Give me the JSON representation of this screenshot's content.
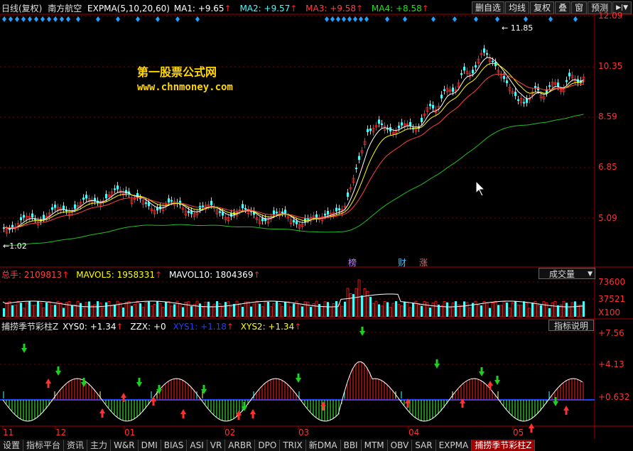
{
  "header": {
    "period": "日线(复权)",
    "stock": "南方航空",
    "indicator": "EXPMA(5,10,20,60)",
    "ma1": "MA1: +9.65",
    "ma2": "MA2: +9.57",
    "ma3": "MA3: +9.58",
    "ma4": "MA4: +8.58",
    "buttons": [
      "删自选",
      "均线",
      "复权",
      "叠",
      "窗",
      "预测"
    ],
    "nav_icon": "arrow-icon"
  },
  "watermark": {
    "line1": "第一股票公式网",
    "line2": "www.chnmoney.com"
  },
  "price_axis": [
    "12.09",
    "10.35",
    "8.59",
    "6.85",
    "5.09"
  ],
  "high_label": "11.85",
  "low_label": "1.02",
  "event_flags": [
    {
      "text": "榜",
      "color": "#c080ff"
    },
    {
      "text": "财",
      "color": "#40c0ff"
    },
    {
      "text": "涨",
      "color": "#ff6060"
    }
  ],
  "volume": {
    "total": "总手: 2109813",
    "mavol5": "MAVOL5: 1958331",
    "mavol10": "MAVOL10: 1804369",
    "dropdown": "成交量",
    "axis": [
      "73600",
      "37521",
      "X100"
    ]
  },
  "indicator_panel": {
    "name": "捕捞季节彩柱Z",
    "xys0": "XYS0: +1.34",
    "zzx": "ZZX: +0",
    "xys1": "XYS1: +1.18",
    "xys2": "XYS2: +1.34",
    "explain": "指标说明",
    "axis": [
      "+7.56",
      "+4.13",
      "+0.632"
    ]
  },
  "time_axis": [
    "11",
    "12",
    "01",
    "02",
    "03",
    "04",
    "05"
  ],
  "tabs": [
    "设置",
    "指标平台",
    "资讯",
    "主力",
    "W&R",
    "DMI",
    "BIAS",
    "ASI",
    "VR",
    "ARBR",
    "DPO",
    "TRIX",
    "新DMA",
    "BBI",
    "MTM",
    "OBV",
    "SAR",
    "EXPMA",
    "捕捞季节彩柱Z"
  ],
  "colors": {
    "up": "#ff2020",
    "down": "#40ffff",
    "ma_white": "#ffffff",
    "ma_yellow": "#ffff00",
    "ma_red": "#ff4040",
    "ma_green": "#20c020",
    "grid": "#a00000"
  }
}
